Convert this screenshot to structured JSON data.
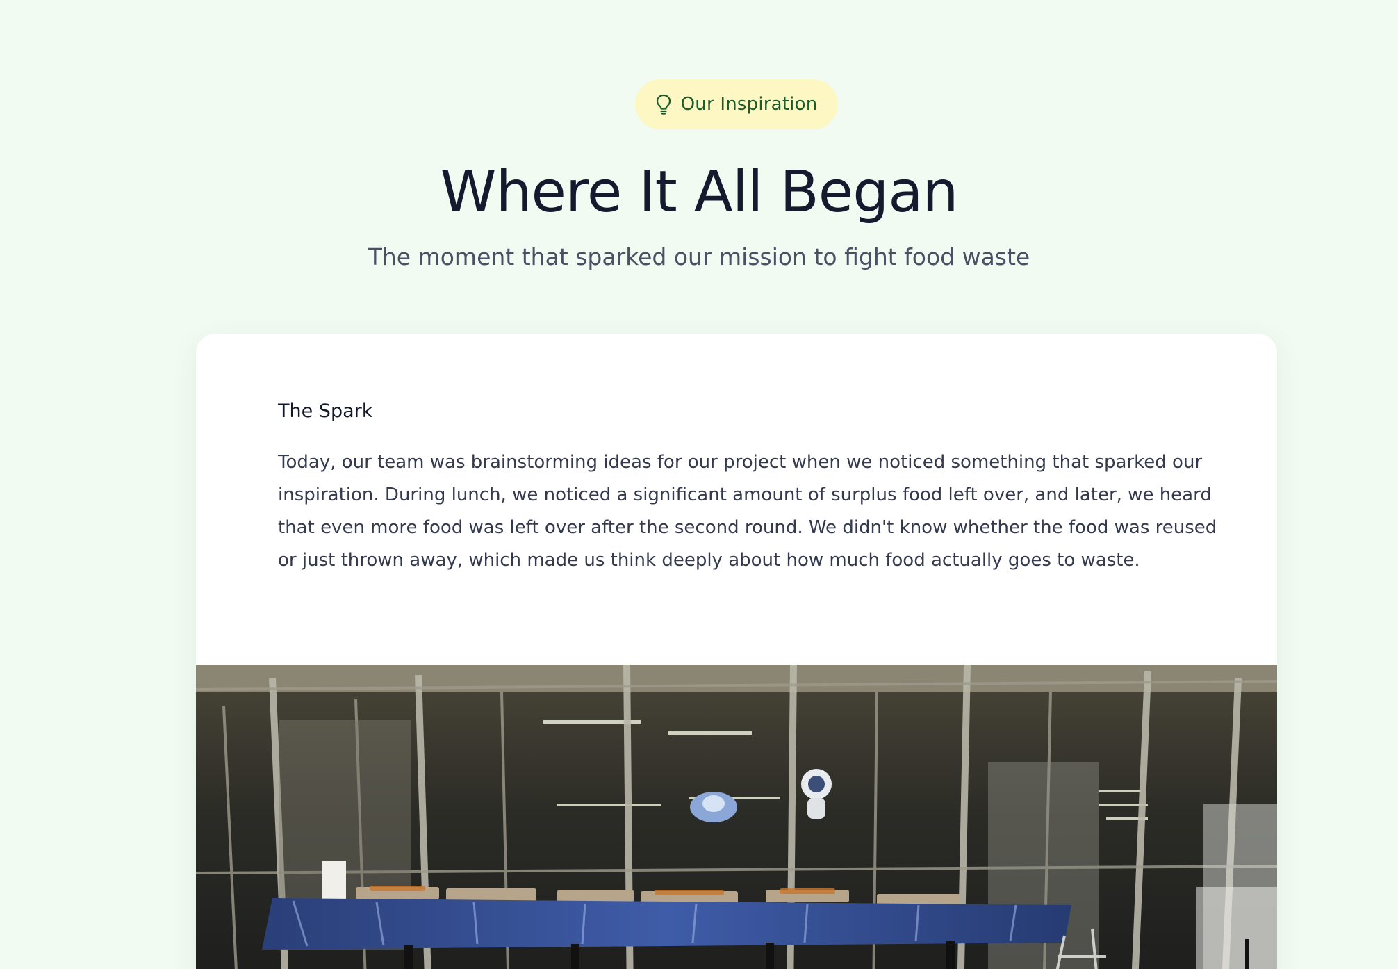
{
  "badge": {
    "label": "Our Inspiration",
    "icon": "lightbulb-icon"
  },
  "header": {
    "title": "Where It All Began",
    "subtitle": "The moment that sparked our mission to fight food waste"
  },
  "card": {
    "heading": "The Spark",
    "body": "Today, our team was brainstorming ideas for our project when we noticed something that sparked our inspiration. During lunch, we noticed a significant amount of surplus food left over, and later, we heard that even more food was left over after the second round. We didn't know whether the food was reused or just thrown away, which made us think deeply about how much food actually goes to waste."
  },
  "colors": {
    "background": "#f1fbf2",
    "badge_bg": "#fdf7c3",
    "badge_text": "#1d5a2c",
    "title": "#161a2e"
  }
}
